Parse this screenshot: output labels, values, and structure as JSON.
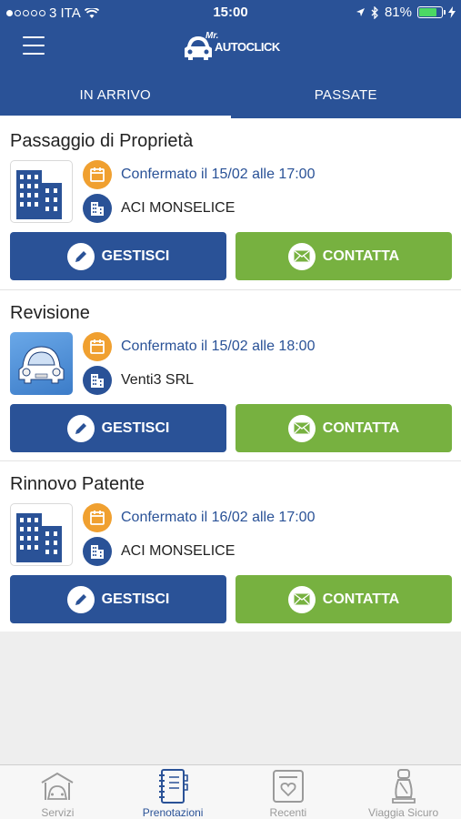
{
  "status_bar": {
    "carrier": "3 ITA",
    "time": "15:00",
    "battery": "81%",
    "battery_level": 0.81
  },
  "app": {
    "logo_small": "Mr.",
    "logo_main": "AUTOCLICK"
  },
  "tabs": [
    {
      "label": "IN ARRIVO",
      "active": true
    },
    {
      "label": "PASSATE",
      "active": false
    }
  ],
  "bookings": [
    {
      "title": "Passaggio di Proprietà",
      "thumb": "building-icon",
      "status": "Confermato il 15/02 alle 17:00",
      "place": "ACI MONSELICE",
      "manage_label": "GESTISCI",
      "contact_label": "CONTATTA"
    },
    {
      "title": "Revisione",
      "thumb": "car-icon",
      "status": "Confermato il 15/02 alle 18:00",
      "place": "Venti3 SRL",
      "manage_label": "GESTISCI",
      "contact_label": "CONTATTA"
    },
    {
      "title": "Rinnovo Patente",
      "thumb": "building-icon",
      "status": "Confermato il 16/02 alle 17:00",
      "place": "ACI MONSELICE",
      "manage_label": "GESTISCI",
      "contact_label": "CONTATTA"
    }
  ],
  "tabbar": [
    {
      "label": "Servizi",
      "icon": "garage-icon",
      "active": false
    },
    {
      "label": "Prenotazioni",
      "icon": "agenda-icon",
      "active": true
    },
    {
      "label": "Recenti",
      "icon": "favorite-icon",
      "active": false
    },
    {
      "label": "Viaggia Sicuro",
      "icon": "car-seat-icon",
      "active": false
    }
  ],
  "colors": {
    "primary": "#2a5297",
    "accent_green": "#77b140",
    "accent_orange": "#f0a030"
  }
}
